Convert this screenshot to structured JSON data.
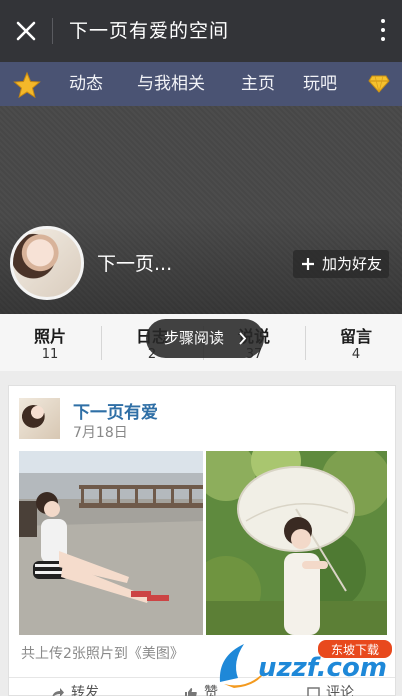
{
  "appbar": {
    "title": "下一页有爱的空间"
  },
  "navbar": {
    "tabs": [
      "动态",
      "与我相关",
      "主页",
      "玩吧"
    ]
  },
  "profile": {
    "name": "下一页...",
    "add_friend": "加为好友"
  },
  "stats": [
    {
      "label": "照片",
      "count": "11"
    },
    {
      "label": "日志",
      "count": "2"
    },
    {
      "label": "说说",
      "count": "37"
    },
    {
      "label": "留言",
      "count": "4"
    }
  ],
  "read_mode": "步骤阅读",
  "feed": {
    "author": "下一页有爱",
    "date": "7月18日",
    "caption": "共上传2张照片到《美图》",
    "actions": [
      "转发",
      "赞",
      "评论"
    ]
  },
  "watermark": {
    "logo_text": "uzzf.com",
    "badge": "东坡下载"
  }
}
